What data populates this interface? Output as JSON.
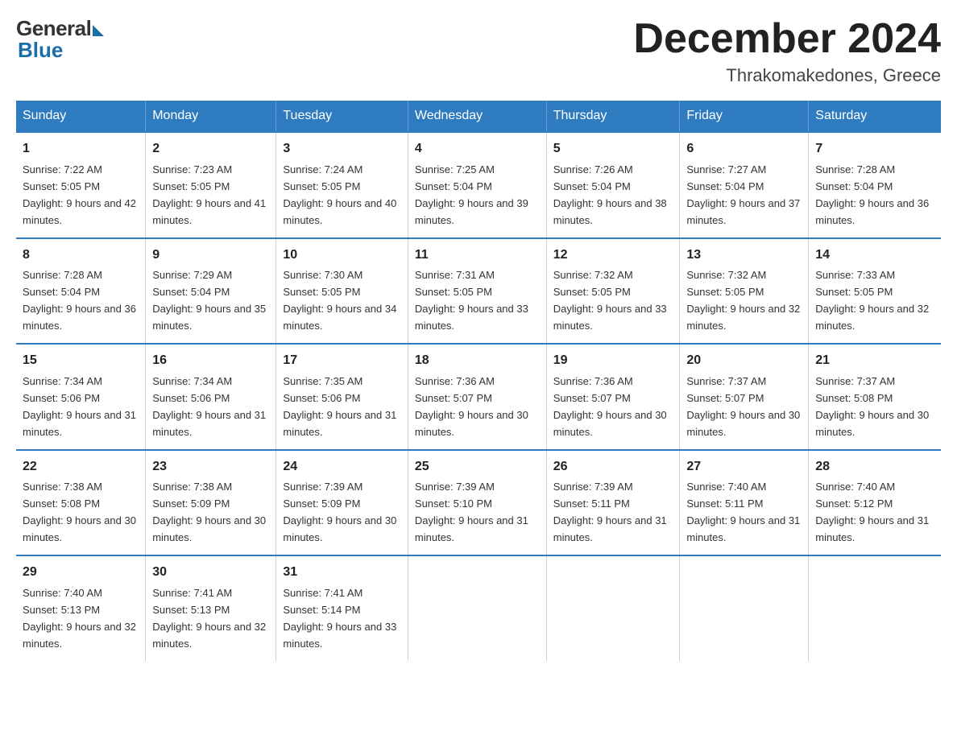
{
  "header": {
    "logo_general": "General",
    "logo_blue": "Blue",
    "main_title": "December 2024",
    "subtitle": "Thrakomakedones, Greece"
  },
  "days_of_week": [
    "Sunday",
    "Monday",
    "Tuesday",
    "Wednesday",
    "Thursday",
    "Friday",
    "Saturday"
  ],
  "weeks": [
    [
      {
        "day": "1",
        "sunrise": "7:22 AM",
        "sunset": "5:05 PM",
        "daylight": "9 hours and 42 minutes."
      },
      {
        "day": "2",
        "sunrise": "7:23 AM",
        "sunset": "5:05 PM",
        "daylight": "9 hours and 41 minutes."
      },
      {
        "day": "3",
        "sunrise": "7:24 AM",
        "sunset": "5:05 PM",
        "daylight": "9 hours and 40 minutes."
      },
      {
        "day": "4",
        "sunrise": "7:25 AM",
        "sunset": "5:04 PM",
        "daylight": "9 hours and 39 minutes."
      },
      {
        "day": "5",
        "sunrise": "7:26 AM",
        "sunset": "5:04 PM",
        "daylight": "9 hours and 38 minutes."
      },
      {
        "day": "6",
        "sunrise": "7:27 AM",
        "sunset": "5:04 PM",
        "daylight": "9 hours and 37 minutes."
      },
      {
        "day": "7",
        "sunrise": "7:28 AM",
        "sunset": "5:04 PM",
        "daylight": "9 hours and 36 minutes."
      }
    ],
    [
      {
        "day": "8",
        "sunrise": "7:28 AM",
        "sunset": "5:04 PM",
        "daylight": "9 hours and 36 minutes."
      },
      {
        "day": "9",
        "sunrise": "7:29 AM",
        "sunset": "5:04 PM",
        "daylight": "9 hours and 35 minutes."
      },
      {
        "day": "10",
        "sunrise": "7:30 AM",
        "sunset": "5:05 PM",
        "daylight": "9 hours and 34 minutes."
      },
      {
        "day": "11",
        "sunrise": "7:31 AM",
        "sunset": "5:05 PM",
        "daylight": "9 hours and 33 minutes."
      },
      {
        "day": "12",
        "sunrise": "7:32 AM",
        "sunset": "5:05 PM",
        "daylight": "9 hours and 33 minutes."
      },
      {
        "day": "13",
        "sunrise": "7:32 AM",
        "sunset": "5:05 PM",
        "daylight": "9 hours and 32 minutes."
      },
      {
        "day": "14",
        "sunrise": "7:33 AM",
        "sunset": "5:05 PM",
        "daylight": "9 hours and 32 minutes."
      }
    ],
    [
      {
        "day": "15",
        "sunrise": "7:34 AM",
        "sunset": "5:06 PM",
        "daylight": "9 hours and 31 minutes."
      },
      {
        "day": "16",
        "sunrise": "7:34 AM",
        "sunset": "5:06 PM",
        "daylight": "9 hours and 31 minutes."
      },
      {
        "day": "17",
        "sunrise": "7:35 AM",
        "sunset": "5:06 PM",
        "daylight": "9 hours and 31 minutes."
      },
      {
        "day": "18",
        "sunrise": "7:36 AM",
        "sunset": "5:07 PM",
        "daylight": "9 hours and 30 minutes."
      },
      {
        "day": "19",
        "sunrise": "7:36 AM",
        "sunset": "5:07 PM",
        "daylight": "9 hours and 30 minutes."
      },
      {
        "day": "20",
        "sunrise": "7:37 AM",
        "sunset": "5:07 PM",
        "daylight": "9 hours and 30 minutes."
      },
      {
        "day": "21",
        "sunrise": "7:37 AM",
        "sunset": "5:08 PM",
        "daylight": "9 hours and 30 minutes."
      }
    ],
    [
      {
        "day": "22",
        "sunrise": "7:38 AM",
        "sunset": "5:08 PM",
        "daylight": "9 hours and 30 minutes."
      },
      {
        "day": "23",
        "sunrise": "7:38 AM",
        "sunset": "5:09 PM",
        "daylight": "9 hours and 30 minutes."
      },
      {
        "day": "24",
        "sunrise": "7:39 AM",
        "sunset": "5:09 PM",
        "daylight": "9 hours and 30 minutes."
      },
      {
        "day": "25",
        "sunrise": "7:39 AM",
        "sunset": "5:10 PM",
        "daylight": "9 hours and 31 minutes."
      },
      {
        "day": "26",
        "sunrise": "7:39 AM",
        "sunset": "5:11 PM",
        "daylight": "9 hours and 31 minutes."
      },
      {
        "day": "27",
        "sunrise": "7:40 AM",
        "sunset": "5:11 PM",
        "daylight": "9 hours and 31 minutes."
      },
      {
        "day": "28",
        "sunrise": "7:40 AM",
        "sunset": "5:12 PM",
        "daylight": "9 hours and 31 minutes."
      }
    ],
    [
      {
        "day": "29",
        "sunrise": "7:40 AM",
        "sunset": "5:13 PM",
        "daylight": "9 hours and 32 minutes."
      },
      {
        "day": "30",
        "sunrise": "7:41 AM",
        "sunset": "5:13 PM",
        "daylight": "9 hours and 32 minutes."
      },
      {
        "day": "31",
        "sunrise": "7:41 AM",
        "sunset": "5:14 PM",
        "daylight": "9 hours and 33 minutes."
      },
      null,
      null,
      null,
      null
    ]
  ]
}
